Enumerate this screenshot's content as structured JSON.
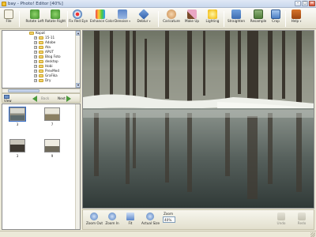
{
  "window": {
    "title": "bay - Photo! Editor [40%]",
    "minimize_glyph": "–",
    "maximize_glyph": "□",
    "close_glyph": "×"
  },
  "toolbar": {
    "file": "File",
    "rotate_left": "Rotate Left",
    "rotate_right": "Rotate Right",
    "fix_red_eye": "Fix Red Eye",
    "enhance_color": "Enhance Color",
    "denoise": "Denoise",
    "deblur": "Deblur",
    "caricature": "Caricature",
    "make_up": "Make Up",
    "lighting": "Lighting",
    "straighten": "Straighten",
    "resample": "Resample",
    "crop": "Crop",
    "help": "Help",
    "dropdown_glyph": "▾"
  },
  "tree": {
    "expander_glyph": "+",
    "items": [
      {
        "label": "Kopat"
      },
      {
        "label": "15-11"
      },
      {
        "label": "Adobe"
      },
      {
        "label": "Ata"
      },
      {
        "label": "APUT"
      },
      {
        "label": "Blog Foto"
      },
      {
        "label": "desktop"
      },
      {
        "label": "Hobi"
      },
      {
        "label": "PrevMed"
      },
      {
        "label": "GraFika"
      },
      {
        "label": "Dry"
      }
    ]
  },
  "nav": {
    "view": "View",
    "back": "Back",
    "next": "Next"
  },
  "thumbnails": [
    {
      "label": "3",
      "selected": true
    },
    {
      "label": "7",
      "selected": false
    },
    {
      "label": "3",
      "selected": false
    },
    {
      "label": "9",
      "selected": false
    }
  ],
  "bottombar": {
    "zoom_out": "Zoom Out",
    "zoom_in": "Zoom In",
    "fit": "Fit",
    "actual_size": "Actual Size",
    "zoom_title": "Zoom",
    "zoom_value": "40%",
    "undo": "Undo",
    "redo": "Redo"
  },
  "colors": {
    "accent": "#316ac5",
    "toolbar_bg": "#e3e0cf",
    "folder": "#f3d36b"
  }
}
